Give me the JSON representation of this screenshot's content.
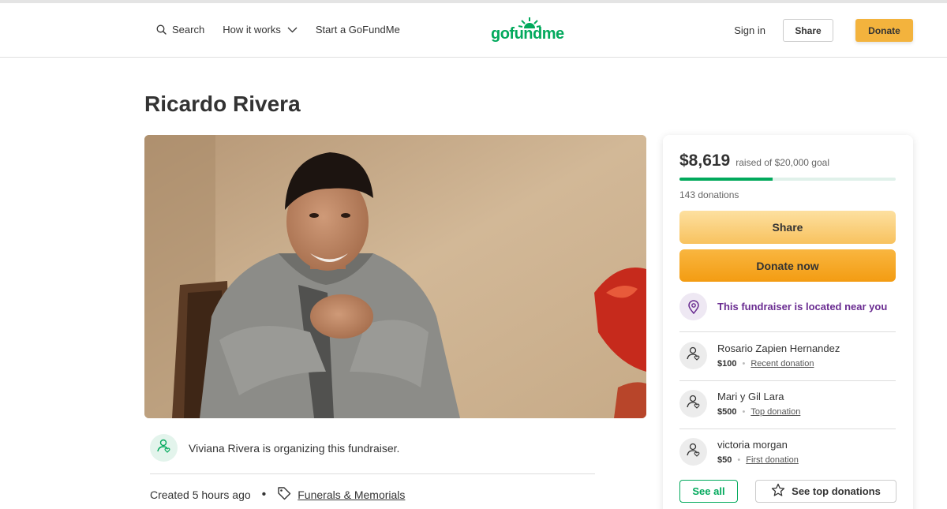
{
  "header": {
    "search_label": "Search",
    "how_it_works_label": "How it works",
    "start_label": "Start a GoFundMe",
    "logo_text": "gofundme",
    "signin_label": "Sign in",
    "share_label": "Share",
    "donate_label": "Donate"
  },
  "campaign": {
    "title": "Ricardo Rivera",
    "organizer_text": "Viviana Rivera is organizing this fundraiser.",
    "created": "Created 5 hours ago",
    "category": "Funerals & Memorials"
  },
  "card": {
    "raised_amount": "$8,619",
    "goal_text": "raised of $20,000 goal",
    "progress_fraction": 0.43,
    "donations_count": "143 donations",
    "share_label": "Share",
    "donate_label": "Donate now",
    "location_text": "This fundraiser is located near you",
    "donors": [
      {
        "name": "Rosario Zapien Hernandez",
        "amount": "$100",
        "type": "Recent donation"
      },
      {
        "name": "Mari y Gil Lara",
        "amount": "$500",
        "type": "Top donation"
      },
      {
        "name": "victoria morgan",
        "amount": "$50",
        "type": "First donation"
      }
    ],
    "see_all_label": "See all",
    "see_top_label": "See top donations"
  },
  "colors": {
    "brand_green": "#02a95c",
    "donate_orange": "#f39c12",
    "location_purple": "#6a2c91"
  },
  "icons": [
    "search-icon",
    "chevron-down-icon",
    "user-heart-icon",
    "tag-icon",
    "location-pin-icon",
    "star-icon"
  ]
}
